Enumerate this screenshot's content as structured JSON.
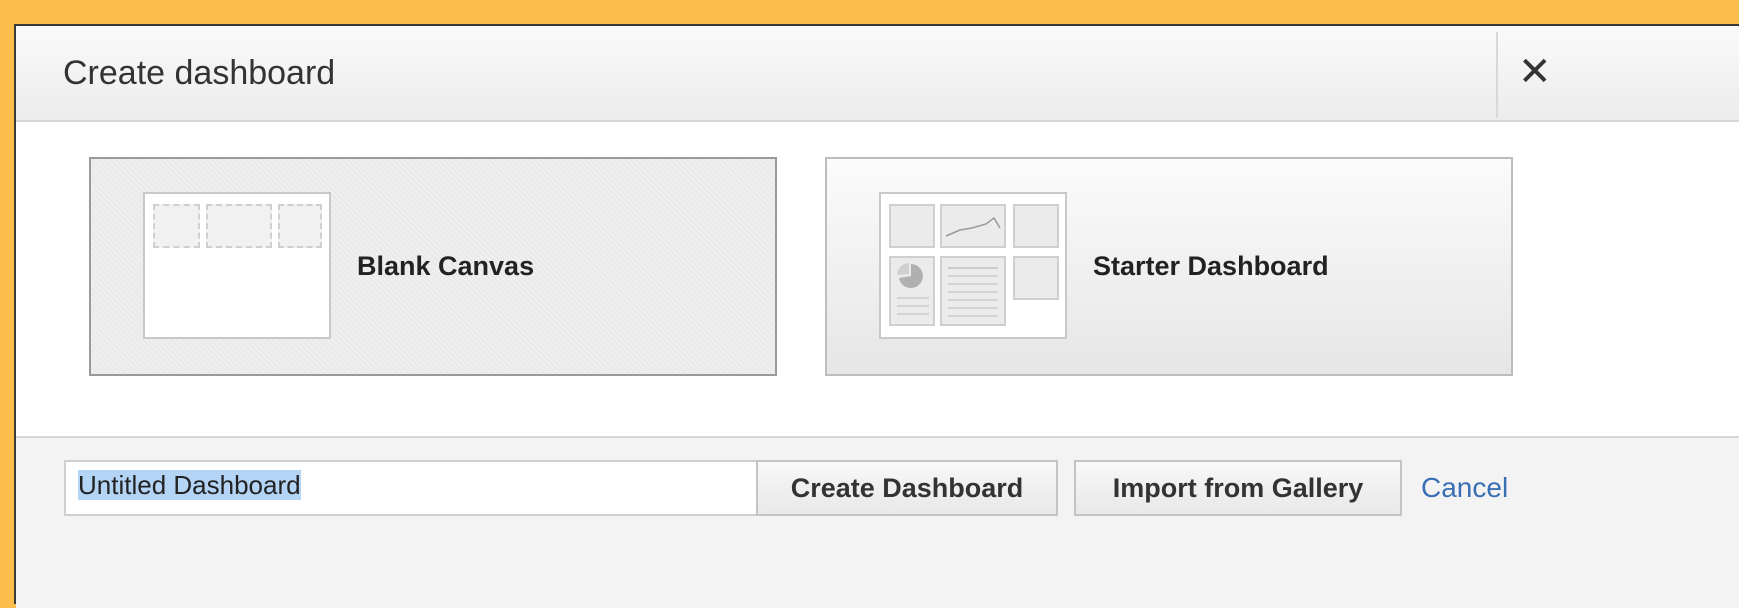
{
  "dialog": {
    "title": "Create dashboard",
    "close_icon": "close-icon"
  },
  "options": [
    {
      "label": "Blank Canvas",
      "icon": "blank-canvas-icon",
      "selected": true
    },
    {
      "label": "Starter Dashboard",
      "icon": "starter-dashboard-icon",
      "selected": false
    }
  ],
  "footer": {
    "name_value": "Untitled Dashboard",
    "create_label": "Create Dashboard",
    "import_label": "Import from Gallery",
    "cancel_label": "Cancel"
  },
  "colors": {
    "background": "#FDBD4C",
    "link": "#3A6FB5",
    "selection": "#B4D4F5"
  }
}
